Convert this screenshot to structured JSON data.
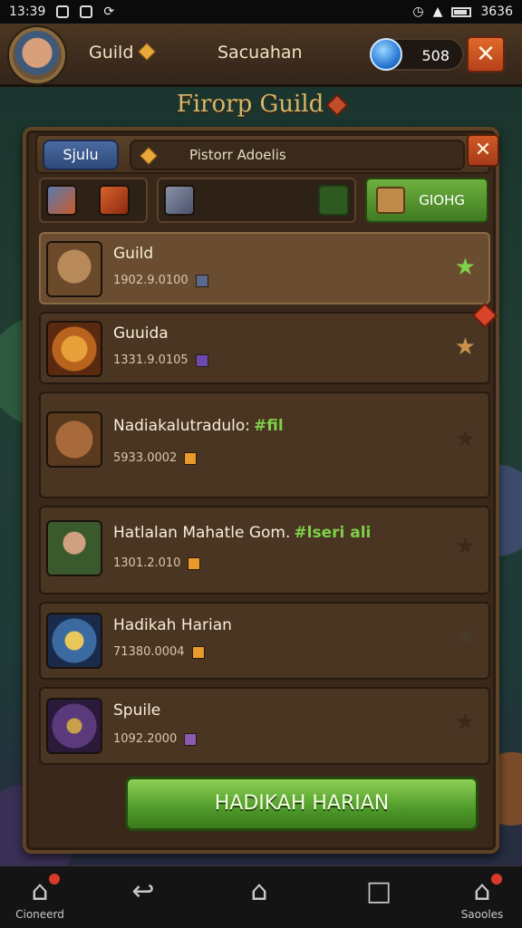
{
  "status_bar": {
    "time": "13:39",
    "right_text": "3636"
  },
  "header": {
    "guild_label": "Guild",
    "title": "Sacuahan",
    "currency_value": "508",
    "close_glyph": "✕"
  },
  "subtitle": "Firorp Guild",
  "panel": {
    "tab_guild": "Sjulu",
    "tab_history": "Pistorr Adoelis",
    "close_glyph": "✕",
    "going_button": "GIOHG",
    "items": [
      {
        "name": "Guild",
        "tag": "",
        "amount": "1902.9.0100",
        "cube_color": "#5a6a8a",
        "fav_color": "#7ed04a",
        "selected": true,
        "alert": false,
        "thumb_icon": "tankard-icon"
      },
      {
        "name": "Guuida",
        "tag": "",
        "amount": "1331.9.0105",
        "cube_color": "#6a4ab0",
        "fav_color": "#c8924a",
        "selected": false,
        "alert": true,
        "thumb_icon": "cannon-icon"
      },
      {
        "name": "Nadiakalutradulo:",
        "tag": "#fil",
        "amount": "5933.0002",
        "cube_color": "#e89a2a",
        "fav_color": "#3a2a1a",
        "selected": false,
        "alert": false,
        "thumb_icon": "barrel-icon"
      },
      {
        "name": "Hatlalan Mahatle Gom.",
        "tag": "#lseri ali",
        "amount": "1301.2.010",
        "cube_color": "#e89a2a",
        "fav_color": "#3a2a1a",
        "selected": false,
        "alert": false,
        "thumb_icon": "hero-portrait-icon"
      },
      {
        "name": "Hadikah Harian",
        "tag": "",
        "amount": "71380.0004",
        "cube_color": "#e89a2a",
        "fav_color": "#4a3a28",
        "selected": false,
        "alert": false,
        "thumb_icon": "staff-icon"
      },
      {
        "name": "Spuile",
        "tag": "",
        "amount": "1092.2000",
        "cube_color": "#8a5ab0",
        "fav_color": "#3a2a1a",
        "selected": false,
        "alert": false,
        "thumb_icon": "scepter-icon"
      }
    ]
  },
  "main_button": "HADIKAH HARIAN",
  "navbar": {
    "left_label": "Cioneerd",
    "right_label": "Saooles"
  }
}
